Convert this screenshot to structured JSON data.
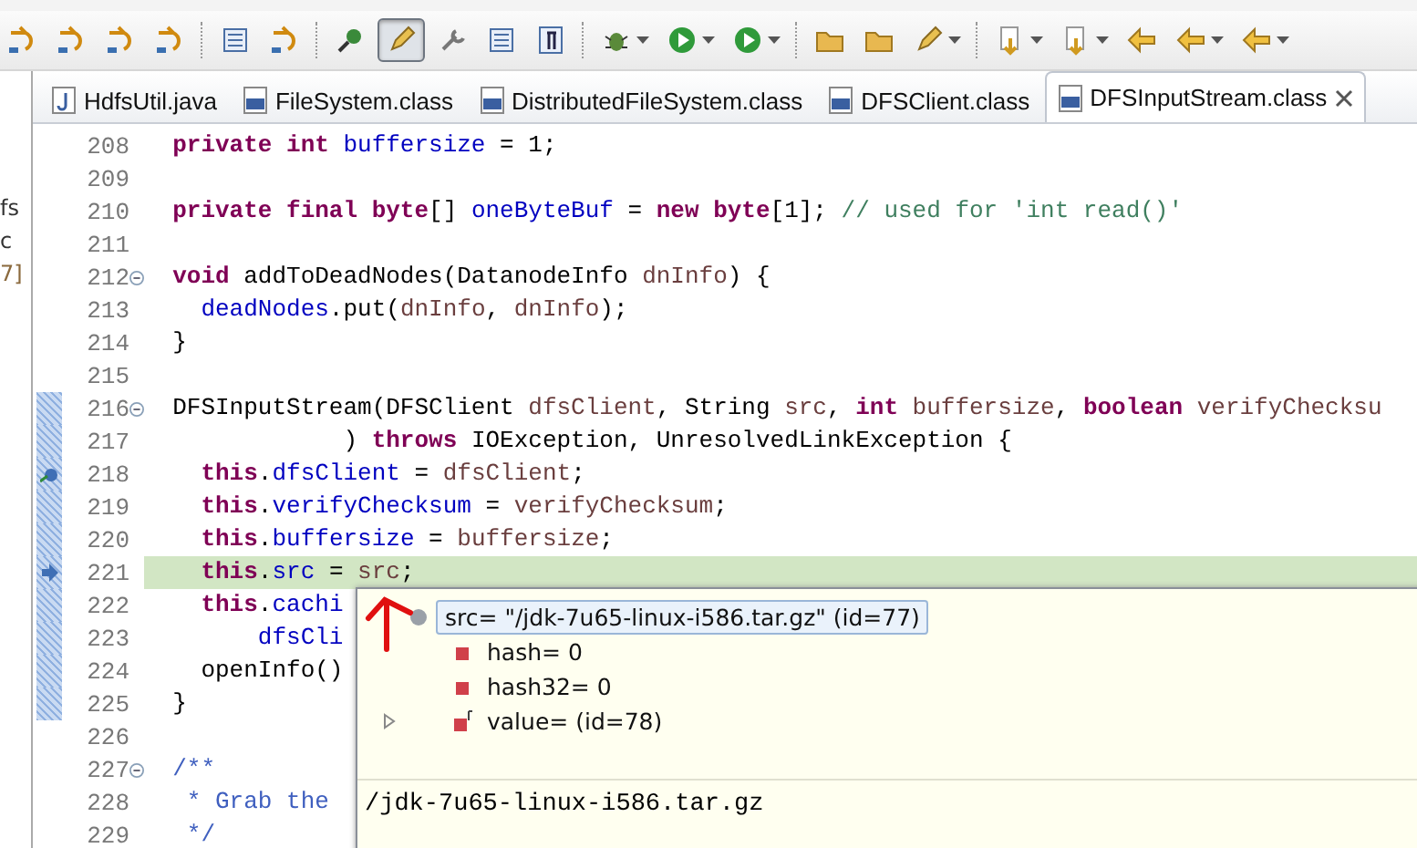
{
  "toolbar": [
    {
      "kind": "step",
      "dropdown": false,
      "pressed": false
    },
    {
      "kind": "step",
      "dropdown": false,
      "pressed": false
    },
    {
      "kind": "step",
      "dropdown": false,
      "pressed": false
    },
    {
      "kind": "step",
      "dropdown": false,
      "pressed": false
    },
    {
      "kind": "sep"
    },
    {
      "kind": "list",
      "dropdown": false,
      "pressed": false
    },
    {
      "kind": "step",
      "dropdown": false,
      "pressed": false
    },
    {
      "kind": "sep"
    },
    {
      "kind": "pin",
      "dropdown": false,
      "pressed": false
    },
    {
      "kind": "pencil",
      "dropdown": false,
      "pressed": true
    },
    {
      "kind": "tool",
      "dropdown": false,
      "pressed": false
    },
    {
      "kind": "list",
      "dropdown": false,
      "pressed": false
    },
    {
      "kind": "para",
      "dropdown": false,
      "pressed": false
    },
    {
      "kind": "sep"
    },
    {
      "kind": "bug",
      "dropdown": true,
      "pressed": false
    },
    {
      "kind": "run",
      "dropdown": true,
      "pressed": false
    },
    {
      "kind": "run",
      "dropdown": true,
      "pressed": false
    },
    {
      "kind": "sep"
    },
    {
      "kind": "folder",
      "dropdown": false,
      "pressed": false
    },
    {
      "kind": "folder",
      "dropdown": false,
      "pressed": false
    },
    {
      "kind": "pencil",
      "dropdown": true,
      "pressed": false
    },
    {
      "kind": "sep"
    },
    {
      "kind": "nav",
      "dropdown": true,
      "pressed": false
    },
    {
      "kind": "nav",
      "dropdown": true,
      "pressed": false
    },
    {
      "kind": "arrow",
      "dropdown": false,
      "pressed": false
    },
    {
      "kind": "arrow",
      "dropdown": true,
      "pressed": false
    },
    {
      "kind": "arrow",
      "dropdown": true,
      "pressed": false
    }
  ],
  "side_panel": {
    "fragments": [
      "fs",
      "c",
      "7]"
    ]
  },
  "tabs": [
    {
      "label": "HdfsUtil.java",
      "kind": "java",
      "selected": false
    },
    {
      "label": "FileSystem.class",
      "kind": "class",
      "selected": false
    },
    {
      "label": "DistributedFileSystem.class",
      "kind": "class",
      "selected": false
    },
    {
      "label": "DFSClient.class",
      "kind": "class",
      "selected": false
    },
    {
      "label": "DFSInputStream.class",
      "kind": "class",
      "selected": true
    }
  ],
  "code_lines": [
    {
      "number": "208",
      "fold": false,
      "in_frame": false,
      "current": false,
      "code": [
        {
          "text": "  private int",
          "kind": "kw"
        },
        {
          "text": " buffersize",
          "kind": "field"
        },
        {
          "text": " = 1;",
          "kind": "plain"
        }
      ]
    },
    {
      "number": "209",
      "fold": false,
      "in_frame": false,
      "current": false
    },
    {
      "number": "210",
      "fold": false,
      "in_frame": false,
      "current": false,
      "code": [
        {
          "text": "  private final byte",
          "kind": "kw"
        },
        {
          "text": "[] ",
          "kind": "plain"
        },
        {
          "text": "oneByteBuf",
          "kind": "field"
        },
        {
          "text": " = ",
          "kind": "plain"
        },
        {
          "text": "new byte",
          "kind": "kw"
        },
        {
          "text": "[1]; ",
          "kind": "plain"
        },
        {
          "text": "// used for 'int read()'",
          "kind": "comment"
        }
      ]
    },
    {
      "number": "211",
      "fold": false,
      "in_frame": false,
      "current": false
    },
    {
      "number": "212",
      "fold": true,
      "in_frame": false,
      "current": false,
      "code": [
        {
          "text": "  void",
          "kind": "kw"
        },
        {
          "text": " addToDeadNodes(DatanodeInfo ",
          "kind": "plain"
        },
        {
          "text": "dnInfo",
          "kind": "local"
        },
        {
          "text": ") {",
          "kind": "plain"
        }
      ]
    },
    {
      "number": "213",
      "fold": false,
      "in_frame": false,
      "current": false,
      "code": [
        {
          "text": "    deadNodes",
          "kind": "field"
        },
        {
          "text": ".put(",
          "kind": "plain"
        },
        {
          "text": "dnInfo",
          "kind": "local"
        },
        {
          "text": ", ",
          "kind": "plain"
        },
        {
          "text": "dnInfo",
          "kind": "local"
        },
        {
          "text": ");",
          "kind": "plain"
        }
      ]
    },
    {
      "number": "214",
      "fold": false,
      "in_frame": false,
      "current": false,
      "code": [
        {
          "text": "  }",
          "kind": "plain"
        }
      ]
    },
    {
      "number": "215",
      "fold": false,
      "in_frame": false,
      "current": false
    },
    {
      "number": "216",
      "fold": true,
      "in_frame": true,
      "current": false,
      "code": [
        {
          "text": "  DFSInputStream(DFSClient ",
          "kind": "plain"
        },
        {
          "text": "dfsClient",
          "kind": "local"
        },
        {
          "text": ", String ",
          "kind": "plain"
        },
        {
          "text": "src",
          "kind": "local"
        },
        {
          "text": ", ",
          "kind": "plain"
        },
        {
          "text": "int",
          "kind": "kw"
        },
        {
          "text": " buffersize",
          "kind": "local"
        },
        {
          "text": ", ",
          "kind": "plain"
        },
        {
          "text": "boolean",
          "kind": "kw"
        },
        {
          "text": " verifyChecksu",
          "kind": "local"
        }
      ]
    },
    {
      "number": "217",
      "fold": false,
      "in_frame": true,
      "current": false,
      "code": [
        {
          "text": "              ) ",
          "kind": "plain"
        },
        {
          "text": "throws",
          "kind": "kw"
        },
        {
          "text": " IOException, UnresolvedLinkException {",
          "kind": "plain"
        }
      ]
    },
    {
      "number": "218",
      "fold": false,
      "in_frame": true,
      "current": false,
      "breakpoint": true,
      "code": [
        {
          "text": "    this",
          "kind": "kw"
        },
        {
          "text": ".",
          "kind": "plain"
        },
        {
          "text": "dfsClient",
          "kind": "field"
        },
        {
          "text": " = ",
          "kind": "plain"
        },
        {
          "text": "dfsClient",
          "kind": "local"
        },
        {
          "text": ";",
          "kind": "plain"
        }
      ]
    },
    {
      "number": "219",
      "fold": false,
      "in_frame": true,
      "current": false,
      "code": [
        {
          "text": "    this",
          "kind": "kw"
        },
        {
          "text": ".",
          "kind": "plain"
        },
        {
          "text": "verifyChecksum",
          "kind": "field"
        },
        {
          "text": " = ",
          "kind": "plain"
        },
        {
          "text": "verifyChecksum",
          "kind": "local"
        },
        {
          "text": ";",
          "kind": "plain"
        }
      ]
    },
    {
      "number": "220",
      "fold": false,
      "in_frame": true,
      "current": false,
      "code": [
        {
          "text": "    this",
          "kind": "kw"
        },
        {
          "text": ".",
          "kind": "plain"
        },
        {
          "text": "buffersize",
          "kind": "field"
        },
        {
          "text": " = ",
          "kind": "plain"
        },
        {
          "text": "buffersize",
          "kind": "local"
        },
        {
          "text": ";",
          "kind": "plain"
        }
      ]
    },
    {
      "number": "221",
      "fold": false,
      "in_frame": true,
      "current": true,
      "instruction_pointer": true,
      "code": [
        {
          "text": "    this",
          "kind": "kw"
        },
        {
          "text": ".",
          "kind": "plain"
        },
        {
          "text": "src",
          "kind": "field"
        },
        {
          "text": " = ",
          "kind": "plain"
        },
        {
          "text": "src",
          "kind": "local"
        },
        {
          "text": ";",
          "kind": "plain"
        }
      ]
    },
    {
      "number": "222",
      "fold": false,
      "in_frame": true,
      "current": false,
      "code": [
        {
          "text": "    this",
          "kind": "kw"
        },
        {
          "text": ".",
          "kind": "plain"
        },
        {
          "text": "cachi",
          "kind": "field"
        }
      ]
    },
    {
      "number": "223",
      "fold": false,
      "in_frame": true,
      "current": false,
      "code": [
        {
          "text": "        dfsCli",
          "kind": "field"
        }
      ]
    },
    {
      "number": "224",
      "fold": false,
      "in_frame": true,
      "current": false,
      "code": [
        {
          "text": "    openInfo()",
          "kind": "plain"
        }
      ]
    },
    {
      "number": "225",
      "fold": false,
      "in_frame": true,
      "current": false,
      "code": [
        {
          "text": "  }",
          "kind": "plain"
        }
      ]
    },
    {
      "number": "226",
      "fold": false,
      "in_frame": false,
      "current": false
    },
    {
      "number": "227",
      "fold": true,
      "in_frame": false,
      "current": false,
      "code": [
        {
          "text": "  /**",
          "kind": "doc"
        }
      ]
    },
    {
      "number": "228",
      "fold": false,
      "in_frame": false,
      "current": false,
      "code": [
        {
          "text": "   * Grab the",
          "kind": "doc"
        }
      ]
    },
    {
      "number": "229",
      "fold": false,
      "in_frame": false,
      "current": false,
      "code": [
        {
          "text": "   */",
          "kind": "doc"
        }
      ]
    }
  ],
  "inspect_popup": {
    "items": [
      {
        "label": "src= \"/jdk-7u65-linux-i586.tar.gz\" (id=77)",
        "kind": "object",
        "selected": true,
        "expandable": false
      },
      {
        "label": "hash= 0",
        "kind": "field",
        "selected": false,
        "expandable": false
      },
      {
        "label": "hash32= 0",
        "kind": "field",
        "selected": false,
        "expandable": false
      },
      {
        "label": "value= (id=78)",
        "kind": "final-field",
        "selected": false,
        "expandable": true
      }
    ],
    "detail": "/jdk-7u65-linux-i586.tar.gz"
  }
}
